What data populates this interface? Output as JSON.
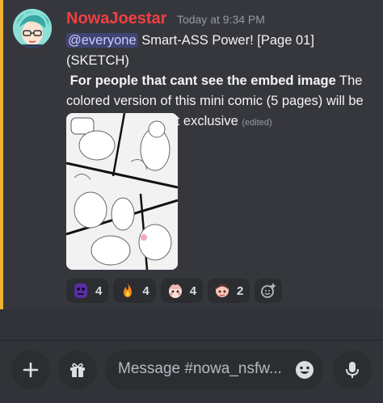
{
  "message": {
    "author": "NowaJoestar",
    "timestamp": "Today at 9:34 PM",
    "mention": "@everyone",
    "title_text": " Smart-ASS Power! [Page 01] (SKETCH)",
    "bold_text": "For people that cant see the embed image",
    "body_text": " The colored version of this mini comic (5 pages) will be Suscription content exclusive",
    "edited_label": "(edited)",
    "author_color": "#f23f42",
    "accent_bar_color": "#f0b232"
  },
  "reactions": [
    {
      "emoji": "purple-face-emoji",
      "count": "4"
    },
    {
      "emoji": "fire-emoji",
      "count": "4"
    },
    {
      "emoji": "custom-emoji-1",
      "count": "4"
    },
    {
      "emoji": "custom-emoji-2",
      "count": "2"
    }
  ],
  "composer": {
    "placeholder": "Message #nowa_nsfw..."
  }
}
